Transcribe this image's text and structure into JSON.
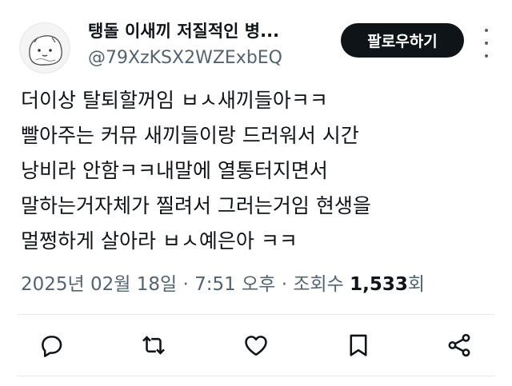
{
  "header": {
    "display_name": "탱돌 이새끼 저질적인 병...",
    "handle": "@79XzKSX2WZExbEQ",
    "follow_label": "팔로우하기"
  },
  "tweet": {
    "text": "더이상 탈퇴할꺼임 ㅂㅅ새끼들아ㅋㅋ\n빨아주는 커뮤 새끼들이랑 드러워서 시간\n낭비라 안함ㅋㅋ내말에 열통터지면서\n말하는거자체가 찔려서 그러는거임 현생을\n멀쩡하게 살아라 ㅂㅅ예은아 ㅋㅋ"
  },
  "meta": {
    "date_time": "2025년 02월 18일 · 7:51 오후 · 조회수 ",
    "views": "1,533",
    "views_suffix": "회"
  },
  "actions": [
    "reply-icon",
    "retweet-icon",
    "like-icon",
    "bookmark-icon",
    "share-icon"
  ],
  "colors": {
    "primary_text": "#0f1419",
    "secondary_text": "#536471",
    "button_bg": "#0f1419"
  }
}
